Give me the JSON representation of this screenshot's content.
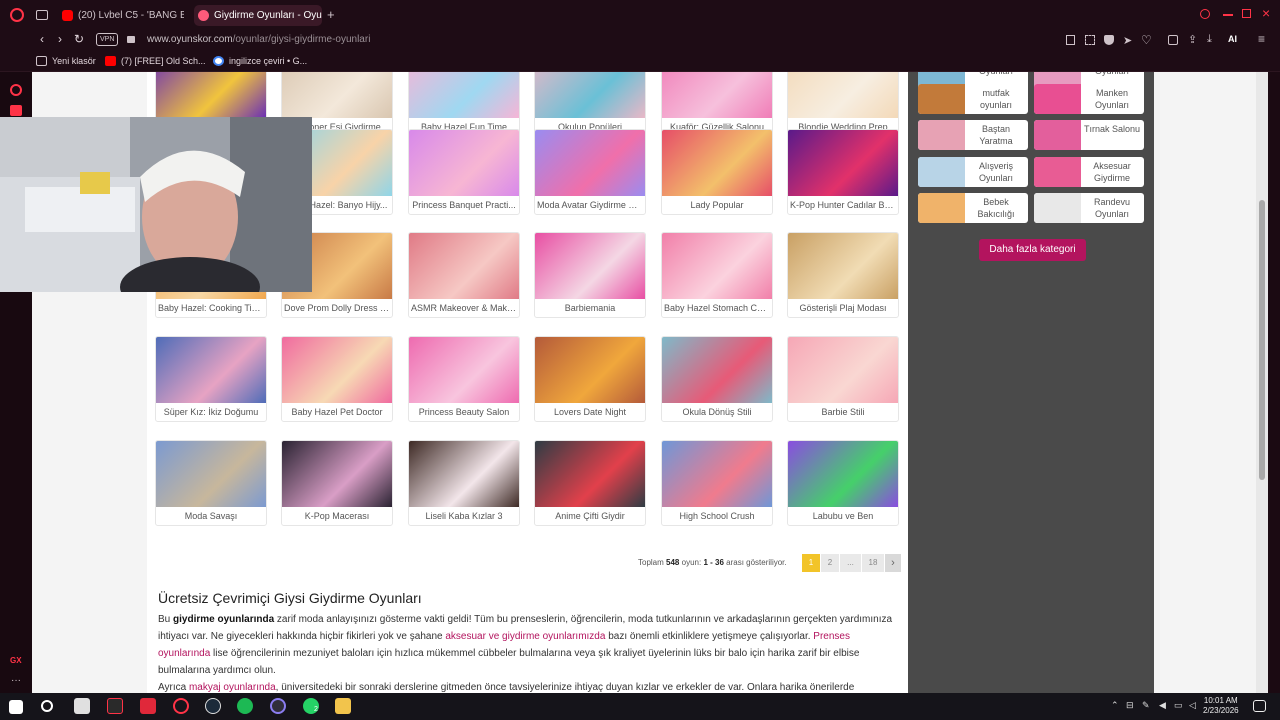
{
  "tabs": [
    {
      "label": "(20) Lvbel C5 - 'BANG BA",
      "icon": "youtube-icon",
      "color": "#ff0000"
    },
    {
      "label": "Giydirme Oyunları - Oyuns",
      "icon": "oyunskor-icon",
      "color": "#ff5a7a"
    }
  ],
  "address": {
    "vpn": "VPN",
    "domain": "www.oyunskor.com",
    "path": "/oyunlar/giysi-giydirme-oyunlari"
  },
  "toolbar_ai": "AI",
  "bookmarks": [
    {
      "label": "Yeni klasör",
      "icon": "folder-icon"
    },
    {
      "label": "(7) [FREE] Old Sch...",
      "icon": "youtube-icon"
    },
    {
      "label": "ingilizce çeviri • G...",
      "icon": "google-icon"
    }
  ],
  "games": [
    {
      "label": "K-Pop Avcı Modası",
      "c1": "#6a2fb5",
      "c2": "#f1c43d"
    },
    {
      "label": "Milyoner Eşi Giydirme",
      "c1": "#d9c6b0",
      "c2": "#f3e8da"
    },
    {
      "label": "Baby Hazel Fun Time",
      "c1": "#f6b5d6",
      "c2": "#9fd8f1"
    },
    {
      "label": "Okulun Popüleri",
      "c1": "#e9b8c7",
      "c2": "#6ac0d6"
    },
    {
      "label": "Kuaför: Güzellik Salonu",
      "c1": "#f07db7",
      "c2": "#f6c0dc"
    },
    {
      "label": "Blondie Wedding Prep",
      "c1": "#f3d9b8",
      "c2": "#f7eee1"
    },
    {
      "label": "Baby Hazel: Banyo Hijy...",
      "c1": "#8fd5e8",
      "c2": "#f8d3a8"
    },
    {
      "label": "Baby Hazel: Banyo Hijy...",
      "c1": "#8fd5e8",
      "c2": "#f8d3a8"
    },
    {
      "label": "Princess Banquet Practi...",
      "c1": "#d889ea",
      "c2": "#f7b6d3"
    },
    {
      "label": "Moda Avatar Giydirme St...",
      "c1": "#9a8cf0",
      "c2": "#f06faa"
    },
    {
      "label": "Lady Popular",
      "c1": "#e64e68",
      "c2": "#f3c06b"
    },
    {
      "label": "K-Pop Hunter Cadılar Ba...",
      "c1": "#5a1a8a",
      "c2": "#e2316a"
    },
    {
      "label": "Baby Hazel: Cooking Time",
      "c1": "#f1a74d",
      "c2": "#f7d7a4"
    },
    {
      "label": "Dove Prom Dolly Dress Up",
      "c1": "#c87a46",
      "c2": "#f2c17a"
    },
    {
      "label": "ASMR Makeover & Make...",
      "c1": "#e07a86",
      "c2": "#f6c8c4"
    },
    {
      "label": "Barbiemania",
      "c1": "#e84fa3",
      "c2": "#f4d7e4"
    },
    {
      "label": "Baby Hazel Stomach Care",
      "c1": "#f17fa9",
      "c2": "#fbd2de"
    },
    {
      "label": "Gösterişli Plaj Modası",
      "c1": "#c9a064",
      "c2": "#f1dcb4"
    },
    {
      "label": "Süper Kız: İkiz Doğumu",
      "c1": "#4f6cb8",
      "c2": "#e7a3c3"
    },
    {
      "label": "Baby Hazel Pet Doctor",
      "c1": "#f06b9f",
      "c2": "#f7d9b4"
    },
    {
      "label": "Princess Beauty Salon",
      "c1": "#ee6bb0",
      "c2": "#f8c5de"
    },
    {
      "label": "Lovers Date Night",
      "c1": "#b45a3a",
      "c2": "#f0a73c"
    },
    {
      "label": "Okula Dönüş Stili",
      "c1": "#7fb9c9",
      "c2": "#e75a77"
    },
    {
      "label": "Barbie Stili",
      "c1": "#f6a7b6",
      "c2": "#f9d7d2"
    },
    {
      "label": "Moda Savaşı",
      "c1": "#7c9ad0",
      "c2": "#c7b79c"
    },
    {
      "label": "K-Pop Macerası",
      "c1": "#2a2332",
      "c2": "#d99ec6"
    },
    {
      "label": "Liseli Kaba Kızlar 3",
      "c1": "#3e2a25",
      "c2": "#f3e6ea"
    },
    {
      "label": "Anime Çifti Giydir",
      "c1": "#2f3c44",
      "c2": "#e2404b"
    },
    {
      "label": "High School Crush",
      "c1": "#6f97d7",
      "c2": "#f07b8d"
    },
    {
      "label": "Labubu ve Ben",
      "c1": "#8a4de0",
      "c2": "#45d06a"
    }
  ],
  "categories": [
    {
      "label": "Oyunları",
      "color": "#7db7d4"
    },
    {
      "label": "Oyunları",
      "color": "#e79bc0"
    },
    {
      "label": "mutfak oyunları",
      "color": "#c27a3a"
    },
    {
      "label": "Manken Oyunları",
      "color": "#e84f92"
    },
    {
      "label": "Baştan Yaratma",
      "color": "#e7a2b4"
    },
    {
      "label": "Tırnak Salonu",
      "color": "#e35f9c"
    },
    {
      "label": "Alışveriş Oyunları",
      "color": "#b8d4e7"
    },
    {
      "label": "Aksesuar Giydirme",
      "color": "#e85c94"
    },
    {
      "label": "Bebek Bakıcılığı",
      "color": "#f0b36a"
    },
    {
      "label": "Randevu Oyunları",
      "color": "#e8e8e8"
    }
  ],
  "more_categories": "Daha fazla kategori",
  "pagination": {
    "info_prefix": "Toplam",
    "total": "548",
    "info_mid": "oyun:",
    "range": "1 - 36",
    "info_suffix": "arası gösteriliyor.",
    "pages": [
      "1",
      "2",
      "...",
      "18"
    ],
    "next": "›"
  },
  "article": {
    "title": "Ücretsiz Çevrimiçi Giysi Giydirme Oyunları",
    "p1_a": "Bu ",
    "p1_b": "giydirme oyunlarında",
    "p1_c": " zarif moda anlayışınızı gösterme vakti geldi! Tüm bu prenseslerin, öğrencilerin, moda tutkunlarının ve arkadaşlarının gerçekten yardımınıza ihtiyacı var. Ne giyecekleri hakkında hiçbir fikirleri yok ve şahane ",
    "p1_link": "aksesuar ve giydirme oyunlarımızda",
    "p1_d": " bazı önemli etkinliklere yetişmeye çalışıyorlar. ",
    "p1_link2": "Prenses oyunlarında",
    "p1_e": " lise öğrencilerinin mezuniyet baloları için hızlıca mükemmel cübbeler bulmalarına veya şık kraliyet üyelerinin lüks bir balo için harika zarif bir elbise bulmalarına yardımcı olun.",
    "p2_a": "Ayrıca ",
    "p2_link": "makyaj oyunlarında",
    "p2_b": ", üniversitedeki bir sonraki derslerine gitmeden önce tavsiyelerinize ihtiyaç duyan kızlar ve erkekler de var. Onlara harika önerilerde"
  },
  "taskbar": {
    "time": "10:01 AM",
    "date": "2/23/2026",
    "whatsapp_badge": "2"
  }
}
